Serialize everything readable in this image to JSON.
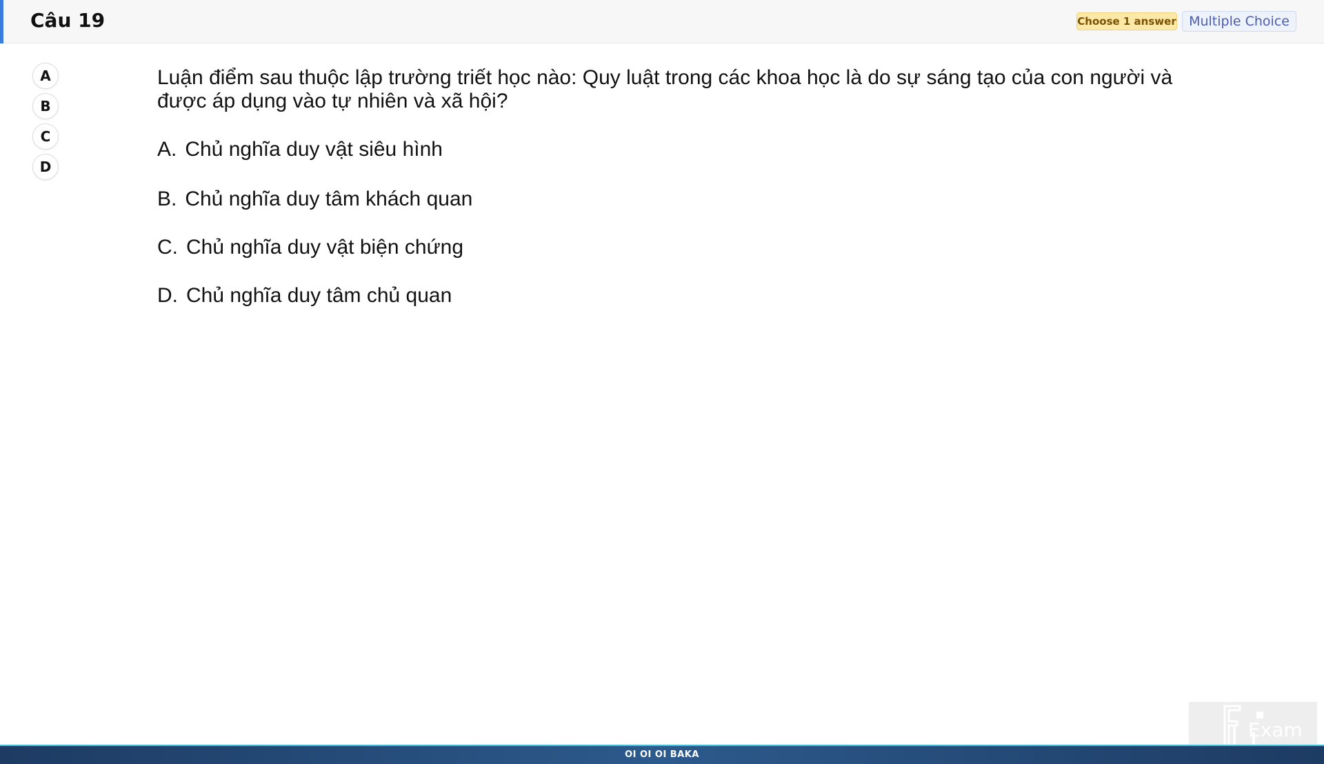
{
  "header": {
    "title": "Câu 19",
    "badge_choose": "Choose 1 answer",
    "badge_type": "Multiple Choice"
  },
  "answer_buttons": [
    "A",
    "B",
    "C",
    "D"
  ],
  "question": {
    "text": "Luận điểm sau thuộc lập trường triết học nào: Quy luật trong các khoa học là do sự sáng tạo của con người và được áp dụng vào tự nhiên và xã hội?",
    "options": [
      {
        "letter": "A.",
        "text": "Chủ nghĩa duy vật siêu hình"
      },
      {
        "letter": "B.",
        "text": "Chủ nghĩa duy tâm khách quan"
      },
      {
        "letter": "C.",
        "text": "Chủ nghĩa duy vật biện chứng"
      },
      {
        "letter": "D.",
        "text": "Chủ nghĩa duy tâm chủ quan"
      }
    ]
  },
  "logo": {
    "text": "Exam"
  },
  "footer": {
    "text": "OI OI OI BAKA"
  }
}
